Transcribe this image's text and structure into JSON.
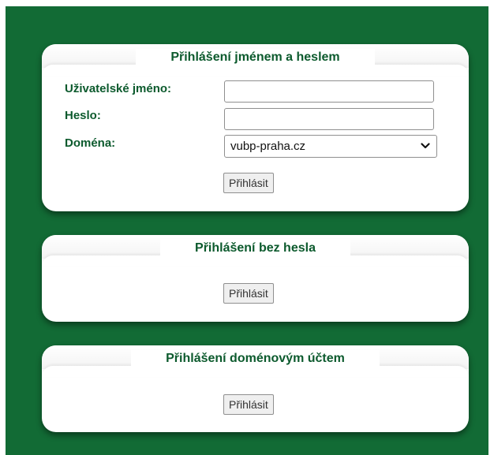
{
  "panels": {
    "password_login": {
      "title": "Přihlášení jménem a heslem",
      "username_label": "Uživatelské jméno:",
      "username_value": "",
      "password_label": "Heslo:",
      "password_value": "",
      "domain_label": "Doména:",
      "domain_selected": "vubp-praha.cz",
      "submit_label": "Přihlásit"
    },
    "passwordless_login": {
      "title": "Přihlášení bez hesla",
      "submit_label": "Přihlásit"
    },
    "domain_account_login": {
      "title": "Přihlášení doménovým účtem",
      "submit_label": "Přihlásit"
    }
  },
  "colors": {
    "background": "#126b35",
    "title_text": "#0c5a2d",
    "panel": "#ffffff"
  },
  "icons": {
    "select_arrow": "chevron-down-icon"
  }
}
